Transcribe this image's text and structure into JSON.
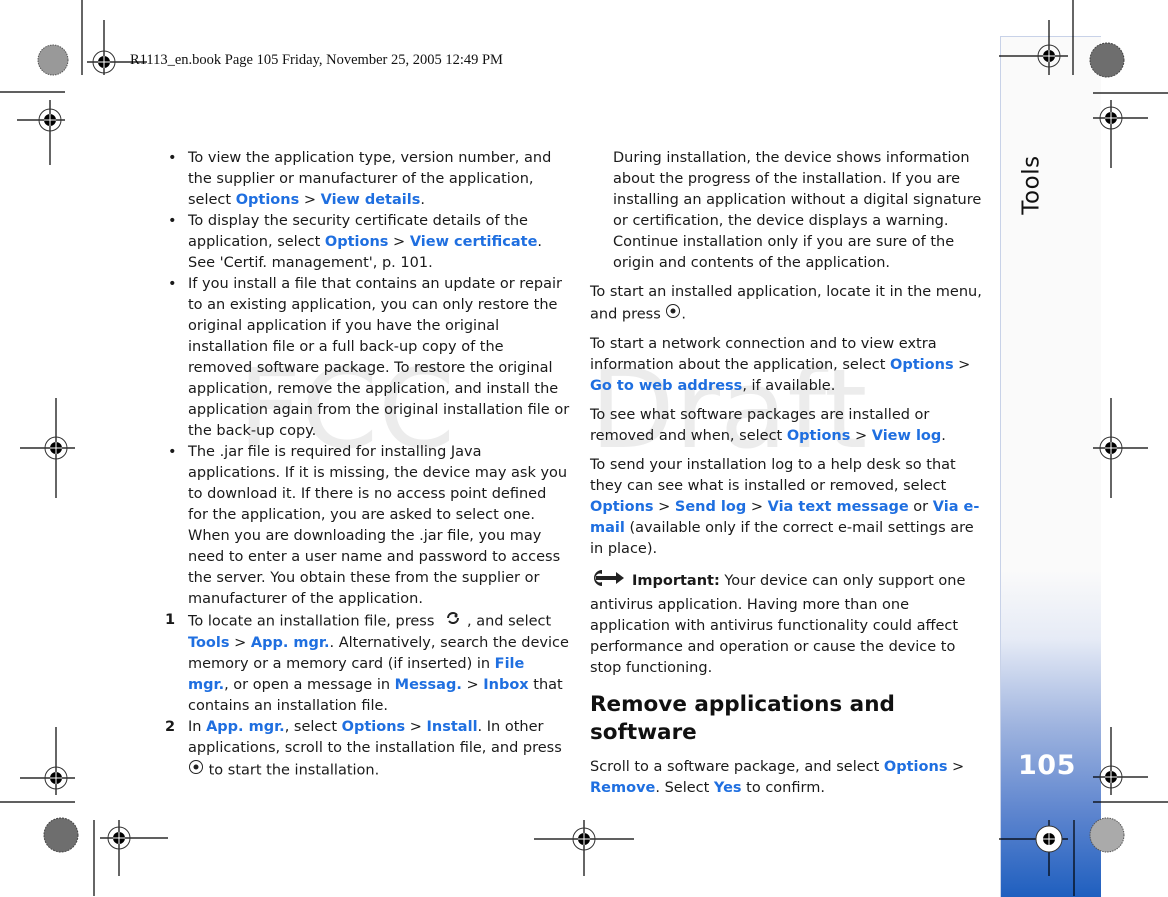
{
  "header": {
    "book_info": "R1113_en.book  Page 105  Friday, November 25, 2005  12:49 PM"
  },
  "sidebar": {
    "section_title": "Tools",
    "page_number": "105",
    "accent_color": "#1f5fbf"
  },
  "watermark": {
    "left_text": "FCC",
    "right_text": "Draft"
  },
  "colors": {
    "link": "#1f6fe0",
    "text": "#1a1a1a"
  },
  "left_column": {
    "bullets": [
      {
        "parts": [
          {
            "t": "To view the application type, version number, and the supplier or manufacturer of the application, select "
          },
          {
            "t": "Options",
            "link": true
          },
          {
            "t": " > "
          },
          {
            "t": "View details",
            "link": true
          },
          {
            "t": "."
          }
        ]
      },
      {
        "parts": [
          {
            "t": "To display the security certificate details of the application, select "
          },
          {
            "t": "Options",
            "link": true
          },
          {
            "t": " > "
          },
          {
            "t": "View certificate",
            "link": true
          },
          {
            "t": ". See 'Certif. management', p. 101."
          }
        ]
      },
      {
        "parts": [
          {
            "t": "If you install a file that contains an update or repair to an existing application, you can only restore the original application if you have the original installation file or a full back-up copy of the removed software package. To restore the original application, remove the application, and install the application again from the original installation file or the back-up copy."
          }
        ]
      },
      {
        "parts": [
          {
            "t": "The .jar file is required for installing Java applications. If it is missing, the device may ask you to download it. If there is no access point defined for the application, you are asked to select one. When you are downloading the .jar file, you may need to enter a user name and password to access the server. You obtain these from the supplier or manufacturer of the application."
          }
        ]
      }
    ],
    "steps": [
      {
        "number": "1",
        "before_icon": "To locate an installation file, press ",
        "icon": "menu-key-icon",
        "parts": [
          {
            "t": ", and select "
          },
          {
            "t": "Tools",
            "link": true
          },
          {
            "t": " > "
          },
          {
            "t": "App. mgr.",
            "link": true
          },
          {
            "t": ". Alternatively, search the device memory or a memory card (if inserted) in "
          },
          {
            "t": "File mgr.",
            "link": true
          },
          {
            "t": ", or open a message in "
          },
          {
            "t": "Messag.",
            "link": true
          },
          {
            "t": " > "
          },
          {
            "t": "Inbox",
            "link": true
          },
          {
            "t": " that contains an installation file."
          }
        ]
      },
      {
        "number": "2",
        "parts": [
          {
            "t": "In "
          },
          {
            "t": "App. mgr.",
            "link": true
          },
          {
            "t": ", select "
          },
          {
            "t": "Options",
            "link": true
          },
          {
            "t": " > "
          },
          {
            "t": "Install",
            "link": true
          },
          {
            "t": ". In other applications, scroll to the installation file, and press "
          }
        ],
        "icon": "select-key-icon",
        "after_icon": " to start the installation."
      }
    ]
  },
  "right_column": {
    "continuation": "During installation, the device shows information about the progress of the installation. If you are installing an application without a digital signature or certification, the device displays a warning. Continue installation only if you are sure of the origin and contents of the application.",
    "start_app": {
      "before_icon": "To start an installed application, locate it in the menu, and press ",
      "icon": "select-key-icon",
      "after_icon": "."
    },
    "paragraphs": [
      {
        "parts": [
          {
            "t": "To start a network connection and to view extra information about the application, select "
          },
          {
            "t": "Options",
            "link": true
          },
          {
            "t": " > "
          },
          {
            "t": "Go to web address",
            "link": true
          },
          {
            "t": ", if available."
          }
        ]
      },
      {
        "parts": [
          {
            "t": "To see what software packages are installed or removed and when, select "
          },
          {
            "t": "Options",
            "link": true
          },
          {
            "t": " > "
          },
          {
            "t": "View log",
            "link": true
          },
          {
            "t": "."
          }
        ]
      },
      {
        "parts": [
          {
            "t": "To send your installation log to a help desk so that they can see what is installed or removed, select "
          },
          {
            "t": "Options",
            "link": true
          },
          {
            "t": " > "
          },
          {
            "t": "Send log",
            "link": true
          },
          {
            "t": " > "
          },
          {
            "t": "Via text message",
            "link": true
          },
          {
            "t": " or "
          },
          {
            "t": "Via e-mail",
            "link": true
          },
          {
            "t": " (available only if the correct e-mail settings are in place)."
          }
        ]
      }
    ],
    "important": {
      "label": "Important:",
      "text": " Your device can only support one antivirus application. Having more than one application with antivirus functionality could affect performance and operation or cause the device to stop functioning."
    },
    "section_heading": "Remove applications and software",
    "remove_paragraph": {
      "parts": [
        {
          "t": "Scroll to a software package, and select "
        },
        {
          "t": "Options",
          "link": true
        },
        {
          "t": " > "
        },
        {
          "t": "Remove",
          "link": true
        },
        {
          "t": ". Select "
        },
        {
          "t": "Yes",
          "link": true
        },
        {
          "t": " to confirm."
        }
      ]
    }
  }
}
